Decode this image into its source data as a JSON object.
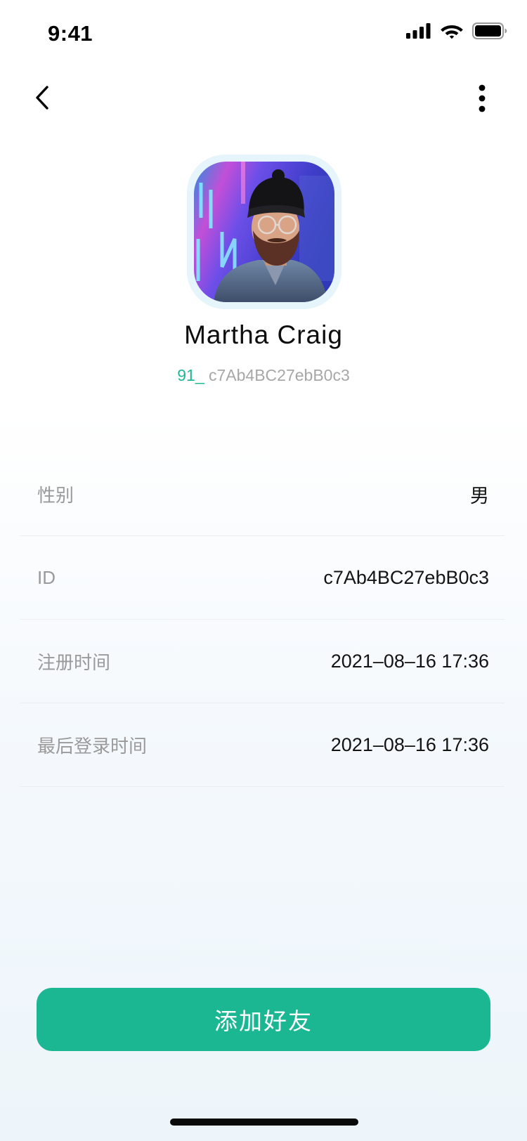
{
  "status_bar": {
    "time": "9:41",
    "icons": [
      "cellular-signal-icon",
      "wifi-icon",
      "battery-icon"
    ]
  },
  "nav": {
    "back_icon": "chevron-left-icon",
    "more_icon": "more-vertical-icon"
  },
  "profile": {
    "name": "Martha Craig",
    "handle_prefix": "91_",
    "handle_id": " c7Ab4BC27ebB0c3"
  },
  "info": [
    {
      "label": "性别",
      "value": "男"
    },
    {
      "label": "ID",
      "value": "c7Ab4BC27ebB0c3"
    },
    {
      "label": "注册时间",
      "value": "2021–08–16 17:36"
    },
    {
      "label": "最后登录时间",
      "value": "2021–08–16 17:36"
    }
  ],
  "actions": {
    "add_friend_label": "添加好友"
  },
  "colors": {
    "accent": "#1ab792",
    "avatar_ring": "#e6f4fb",
    "label": "#9a9a9a"
  }
}
